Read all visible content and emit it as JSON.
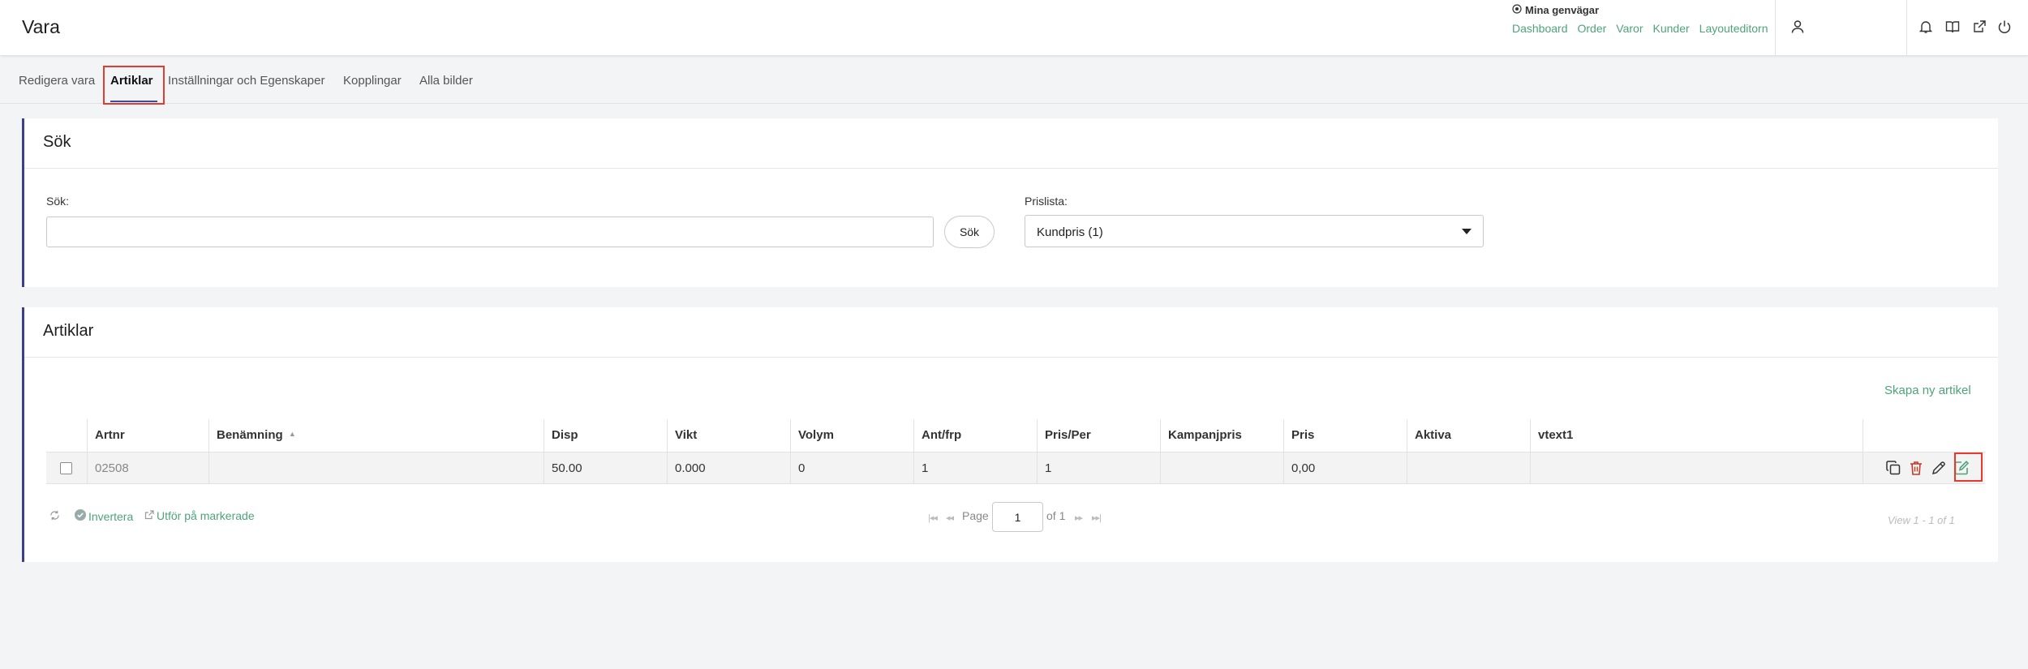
{
  "app": {
    "title": "Vara"
  },
  "shortcuts": {
    "title": "Mina genvägar",
    "links": [
      "Dashboard",
      "Order",
      "Varor",
      "Kunder",
      "Layouteditorn"
    ]
  },
  "tabs": [
    "Redigera vara",
    "Artiklar",
    "Inställningar och Egenskaper",
    "Kopplingar",
    "Alla bilder"
  ],
  "active_tab": "Artiklar",
  "search_panel": {
    "title": "Sök",
    "search_label": "Sök:",
    "search_value": "",
    "search_button": "Sök",
    "pricelist_label": "Prislista:",
    "pricelist_value": "Kundpris (1)"
  },
  "articles_panel": {
    "title": "Artiklar",
    "create_link": "Skapa ny artikel",
    "columns": [
      "Artnr",
      "Benämning",
      "Disp",
      "Vikt",
      "Volym",
      "Ant/frp",
      "Pris/Per",
      "Kampanjpris",
      "Pris",
      "Aktiva",
      "vtext1"
    ],
    "sorted_column": "Benämning",
    "rows": [
      {
        "artnr": "02508",
        "benamning": "",
        "disp": "50.00",
        "vikt": "0.000",
        "volym": "0",
        "antfrp": "1",
        "prisper": "1",
        "kampanjpris": "",
        "pris": "0,00",
        "aktiva": "",
        "vtext1": ""
      }
    ],
    "row_actions": [
      "copy-icon",
      "trash-icon",
      "pencil-icon",
      "edit-square-icon"
    ],
    "footer": {
      "invert_label": "Invertera",
      "execute_label": "Utför på markerade",
      "page_label": "Page",
      "page_value": "1",
      "page_of": "of 1",
      "view_text": "View 1 - 1 of 1"
    }
  },
  "colors": {
    "accent": "#4fa37a",
    "panel_border": "#3b3f8f",
    "highlight": "#e53a2d",
    "delete": "#c0392b"
  }
}
